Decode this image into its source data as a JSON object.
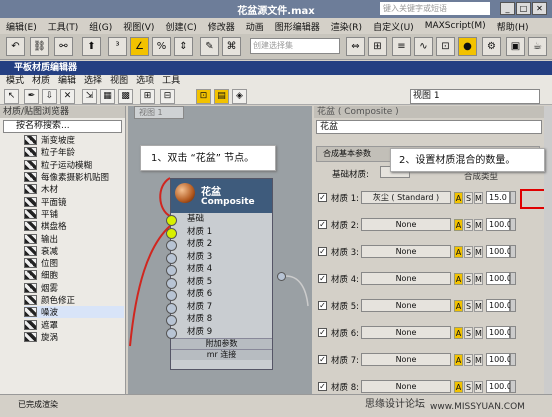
{
  "app": {
    "title": "花盆源文件.max",
    "search_placeholder": "键入关键字或短语"
  },
  "menubar": [
    "编辑(E)",
    "工具(T)",
    "组(G)",
    "视图(V)",
    "创建(C)",
    "修改器",
    "动画",
    "图形编辑器",
    "渲染(R)",
    "自定义(U)",
    "MAXScript(M)",
    "帮助(H)"
  ],
  "toolbar": {
    "selection_set_placeholder": "创建选择集"
  },
  "seme": {
    "title": "平板材质编辑器",
    "menu": [
      "模式",
      "材质",
      "编辑",
      "选择",
      "视图",
      "选项",
      "工具"
    ],
    "view_select": "视图 1"
  },
  "browser": {
    "header": "材质/贴图浏览器",
    "search_placeholder": "按名称搜索...",
    "items": [
      "渐变坡度",
      "粒子年龄",
      "粒子运动模糊",
      "每像素摄影机贴图",
      "木材",
      "平面镜",
      "平铺",
      "棋盘格",
      "输出",
      "衰减",
      "位图",
      "细胞",
      "烟雾",
      "颜色修正",
      "噪波",
      "遮罩",
      "旋涡"
    ],
    "selected_index": 14
  },
  "graph": {
    "tab": "视图 1",
    "node": {
      "name": "花盆",
      "type": "Composite",
      "slots": [
        "基础",
        "材质 1",
        "材质 2",
        "材质 3",
        "材质 4",
        "材质 5",
        "材质 6",
        "材质 7",
        "材质 8",
        "材质 9"
      ],
      "connected_slots": [
        0,
        1
      ],
      "footer": [
        "附加参数",
        "mr 连接"
      ]
    }
  },
  "props": {
    "title": "花盆 ( Composite )",
    "name": "花盆",
    "rollout": "合成基本参数",
    "base_label": "基础材质:",
    "composite_header": "合成类型",
    "rows": [
      {
        "label": "材质 1:",
        "material": "灰尘 ( Standard )",
        "amount": "15.0"
      },
      {
        "label": "材质 2:",
        "material": "None",
        "amount": "100.0"
      },
      {
        "label": "材质 3:",
        "material": "None",
        "amount": "100.0"
      },
      {
        "label": "材质 4:",
        "material": "None",
        "amount": "100.0"
      },
      {
        "label": "材质 5:",
        "material": "None",
        "amount": "100.0"
      },
      {
        "label": "材质 6:",
        "material": "None",
        "amount": "100.0"
      },
      {
        "label": "材质 7:",
        "material": "None",
        "amount": "100.0"
      },
      {
        "label": "材质 8:",
        "material": "None",
        "amount": "100.0"
      }
    ]
  },
  "callouts": {
    "step1": "1、双击 “花盆” 节点。",
    "step2": "2、设置材质混合的数量。"
  },
  "status": {
    "text": "已完成渲染",
    "watermark": "思缘设计论坛",
    "watermark2": "www.MISSYUAN.COM"
  },
  "colors": {
    "accent": "#f2c200",
    "node_header": "#3e5b7c",
    "highlight_box": "#e00000"
  }
}
